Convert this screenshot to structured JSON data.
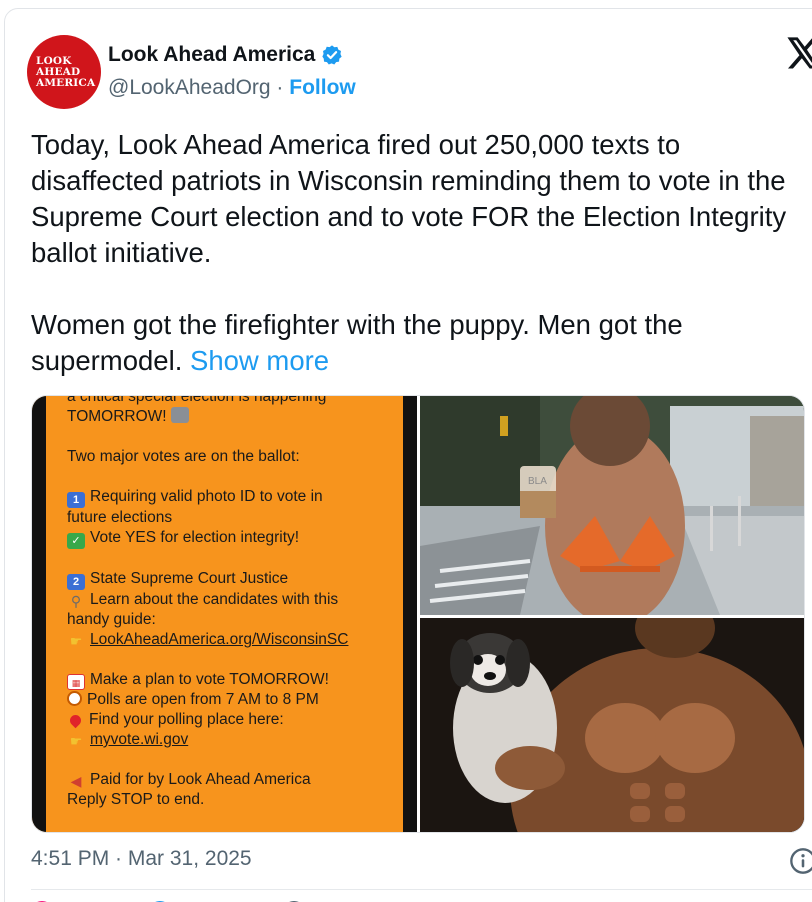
{
  "author": {
    "avatar_text": [
      "LOOK",
      "AHEAD",
      "AMERICA"
    ],
    "name": "Look Ahead America",
    "handle": "@LookAheadOrg",
    "separator": " · ",
    "follow_label": "Follow",
    "verified": true
  },
  "tweet": {
    "paragraph1": "Today, Look Ahead America fired out 250,000 texts to disaffected patriots in Wisconsin reminding them to vote in the Supreme Court election and to vote FOR the Election Integrity ballot initiative.",
    "paragraph2": "Women got the firefighter with the puppy. Men got the supermodel.",
    "show_more_label": "Show more"
  },
  "media": {
    "sms_lines": {
      "l0": "a critical special election is happening",
      "l1": "TOMORROW!",
      "l2": "Two major votes are on the ballot:",
      "l3": "Requiring valid photo ID to vote in",
      "l4": "future elections",
      "l5": "Vote YES for election integrity!",
      "l6": "State Supreme Court Justice",
      "l7": "Learn about the candidates with this",
      "l8": "handy guide:",
      "l9": "LookAheadAmerica.org/WisconsinSC",
      "l10": "Make a plan to vote TOMORROW!",
      "l11": "Polls are open from 7 AM to 8 PM",
      "l12": "Find your polling place here:",
      "l13": "myvote.wi.gov",
      "l14": "Paid for by Look Ahead America",
      "l15": "Reply STOP to end."
    },
    "badge_1": "1",
    "badge_2": "2",
    "cup_label": "BLA"
  },
  "footer": {
    "timestamp": "4:51 PM · Mar 31, 2025"
  },
  "colors": {
    "accent": "#1d9bf0",
    "avatar_bg": "#d0151b",
    "sms_bg": "#f7941d"
  }
}
